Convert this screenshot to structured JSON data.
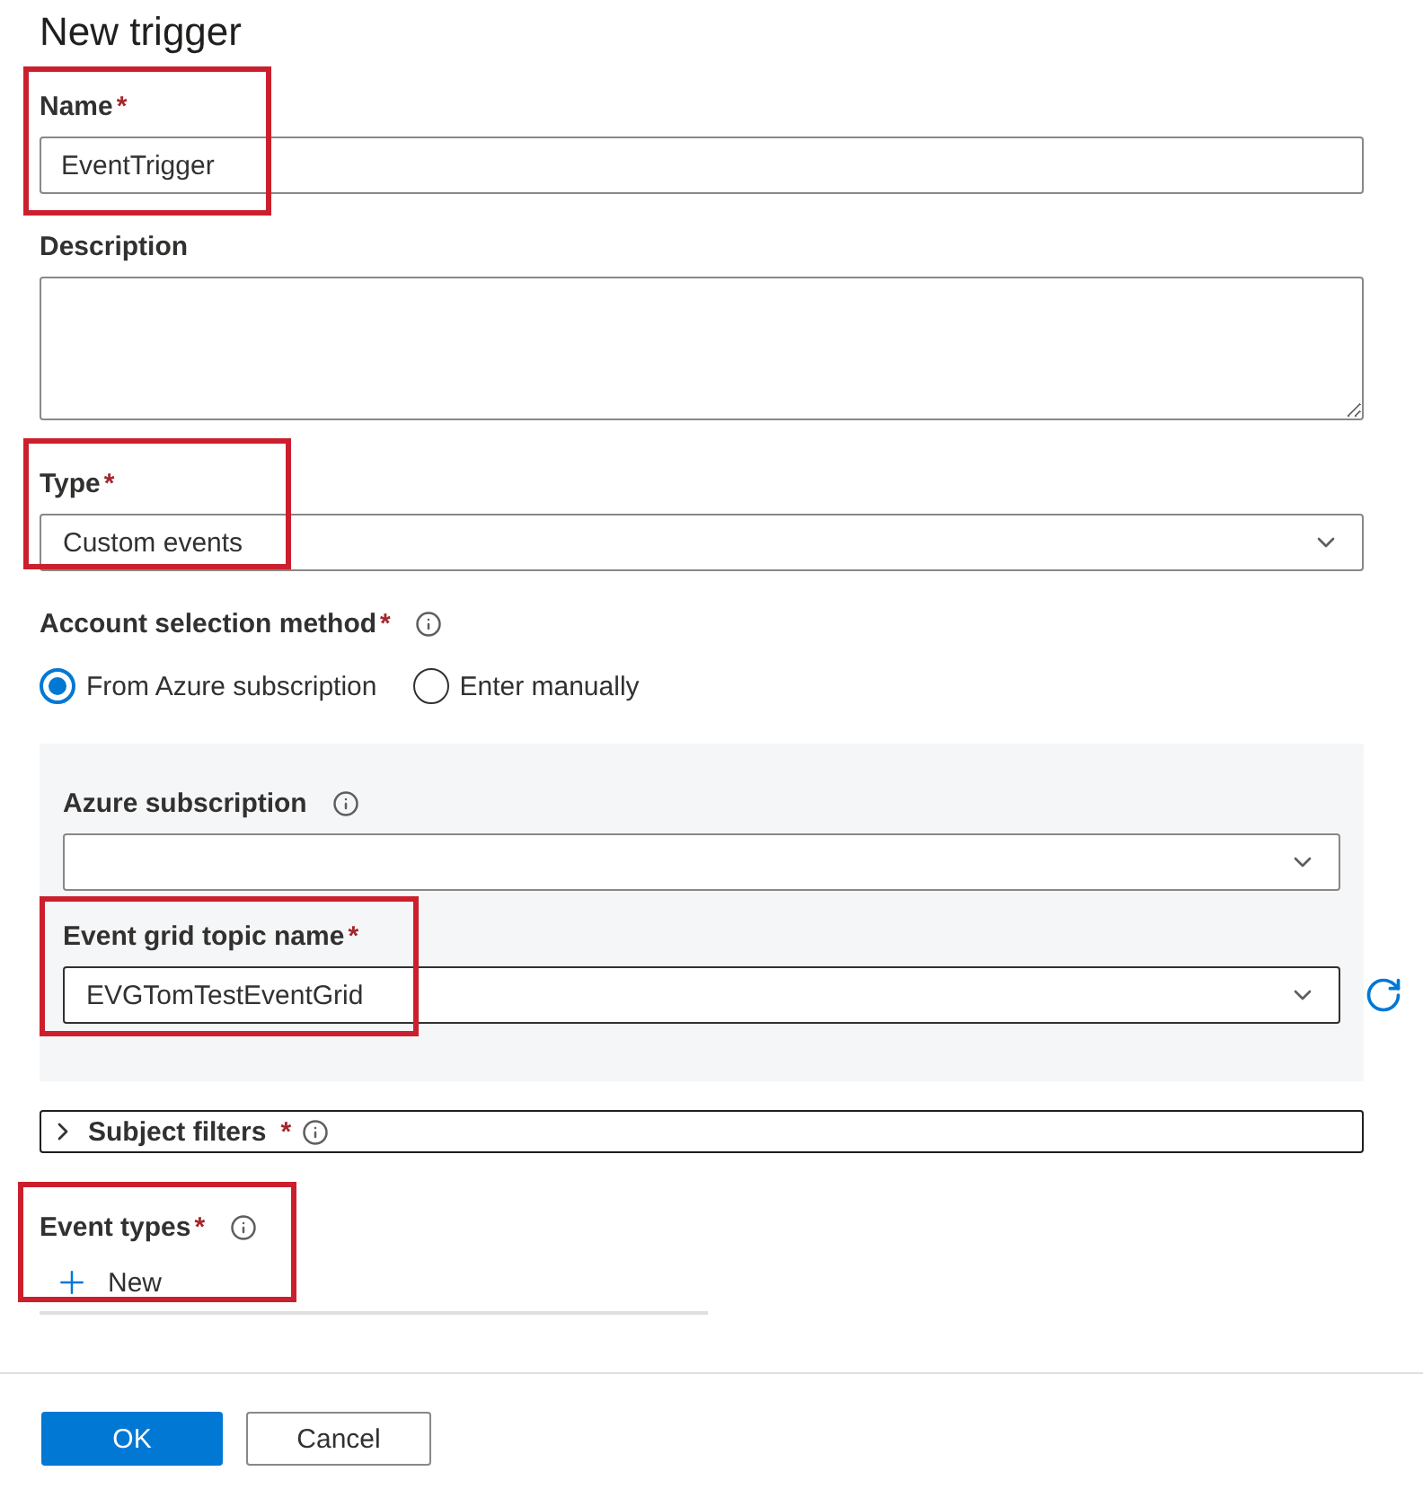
{
  "title": "New trigger",
  "required_mark": "*",
  "fields": [
    {
      "kind": "text",
      "label": "Name",
      "required": true,
      "value": "EventTrigger",
      "highlighted": true
    },
    {
      "kind": "textarea",
      "label": "Description",
      "required": false,
      "highlighted": false
    },
    {
      "kind": "select",
      "label": "Type",
      "required": true,
      "value": "Custom events",
      "highlighted": true
    }
  ],
  "account_selection": {
    "label": "Account selection method",
    "required": true,
    "info": true,
    "options": [
      {
        "label": "From Azure subscription",
        "selected": true
      },
      {
        "label": "Enter manually",
        "selected": false
      }
    ]
  },
  "subscription_panel": [
    {
      "label": "Azure subscription",
      "required": false,
      "info": true,
      "highlighted": false,
      "refresh": false
    },
    {
      "label": "Event grid topic name",
      "required": true,
      "info": false,
      "value": "EVGTomTestEventGrid",
      "highlighted": true,
      "refresh": true
    }
  ],
  "subject_filters": {
    "label": "Subject filters",
    "required": true,
    "info": true,
    "expanded": false
  },
  "event_types": {
    "label": "Event types",
    "required": true,
    "info": true,
    "highlighted": true,
    "new_button": "New"
  },
  "buttons": [
    {
      "label": "OK",
      "kind": "primary"
    },
    {
      "label": "Cancel",
      "kind": "secondary"
    }
  ]
}
